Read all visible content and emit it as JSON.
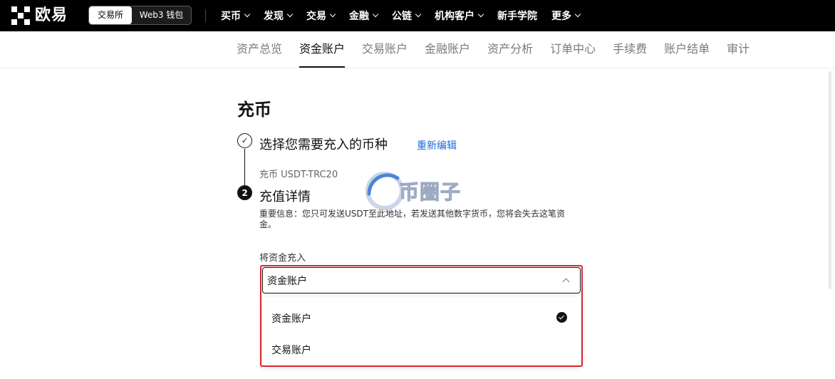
{
  "brand": {
    "name": "欧易"
  },
  "mode_switch": {
    "active": "交易所",
    "inactive": "Web3 钱包"
  },
  "nav": [
    {
      "label": "买币",
      "dropdown": true
    },
    {
      "label": "发现",
      "dropdown": true
    },
    {
      "label": "交易",
      "dropdown": true
    },
    {
      "label": "金融",
      "dropdown": true
    },
    {
      "label": "公链",
      "dropdown": true
    },
    {
      "label": "机构客户",
      "dropdown": true
    },
    {
      "label": "新手学院",
      "dropdown": false
    },
    {
      "label": "更多",
      "dropdown": true
    }
  ],
  "subnav": [
    {
      "label": "资产总览",
      "active": false
    },
    {
      "label": "资金账户",
      "active": true
    },
    {
      "label": "交易账户",
      "active": false
    },
    {
      "label": "金融账户",
      "active": false
    },
    {
      "label": "资产分析",
      "active": false
    },
    {
      "label": "订单中心",
      "active": false
    },
    {
      "label": "手续费",
      "active": false
    },
    {
      "label": "账户结单",
      "active": false
    },
    {
      "label": "审计",
      "active": false
    }
  ],
  "page": {
    "title": "充币"
  },
  "step1": {
    "title": "选择您需要充入的币种",
    "reedit": "重新编辑",
    "summary": "充币 USDT-TRC20",
    "icon": "check-icon"
  },
  "step2": {
    "number": "2",
    "title": "充值详情",
    "notice": "重要信息：您只可发送USDT至此地址，若发送其他数字货币，您将会失去这笔资金。"
  },
  "deposit_to": {
    "label": "将资金充入",
    "selected": "资金账户",
    "options": [
      {
        "label": "资金账户",
        "selected": true
      },
      {
        "label": "交易账户",
        "selected": false
      }
    ]
  },
  "watermark": {
    "text": "币圈子"
  },
  "colors": {
    "topbar": "#000000",
    "link": "#1b6bd8",
    "highlight": "#d9262c"
  }
}
